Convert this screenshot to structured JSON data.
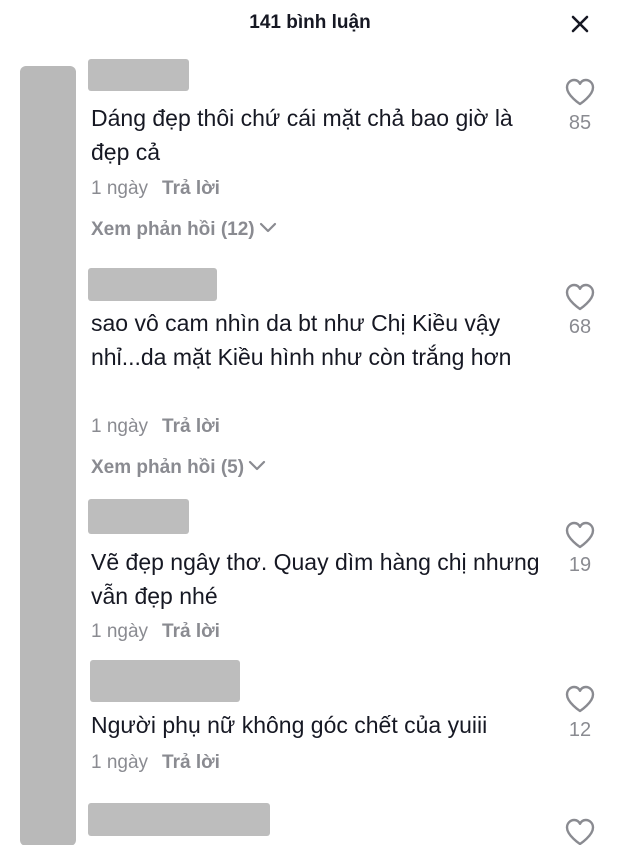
{
  "header": {
    "title": "141 bình luận",
    "close_icon": "close-icon"
  },
  "comments": [
    {
      "text": "Dáng đẹp thôi chứ cái mặt chả bao giờ là đẹp cả",
      "time": "1 ngày",
      "reply_label": "Trả lời",
      "view_replies": "Xem phản hồi (12)",
      "likes": "85"
    },
    {
      "text": "sao vô cam nhìn da bt như Chị Kiều vậy nhỉ...da mặt Kiều hình như còn trắng hơn",
      "time": "1 ngày",
      "reply_label": "Trả lời",
      "view_replies": "Xem phản hồi (5)",
      "likes": "68"
    },
    {
      "text": "Vẽ đẹp ngây thơ. Quay dìm hàng chị nhưng vẫn đẹp nhé",
      "time": "1 ngày",
      "reply_label": "Trả lời",
      "likes": "19"
    },
    {
      "text": "Người phụ nữ không góc chết của yuiii",
      "time": "1 ngày",
      "reply_label": "Trả lời",
      "likes": "12"
    }
  ],
  "colors": {
    "text": "#161823",
    "secondary": "#8a8b91",
    "redaction": "#bdbdbd"
  }
}
